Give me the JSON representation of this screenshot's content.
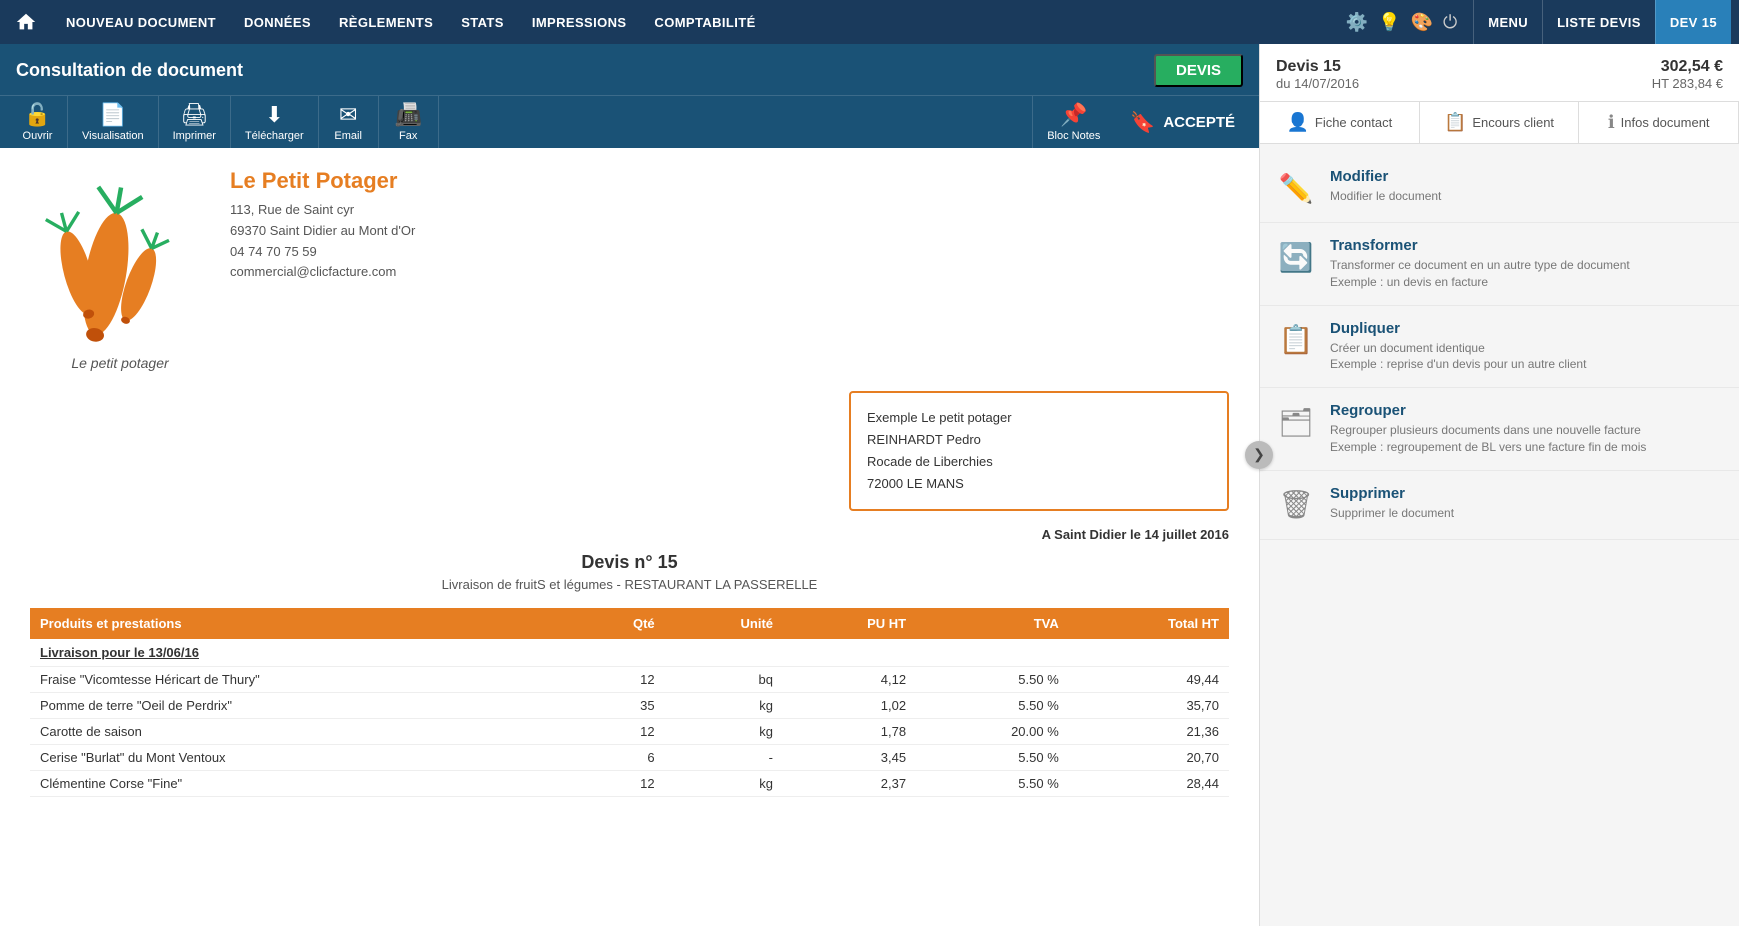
{
  "topNav": {
    "home_icon": "🏠",
    "items": [
      {
        "label": "NOUVEAU DOCUMENT",
        "active": false
      },
      {
        "label": "DONNÉES",
        "active": false
      },
      {
        "label": "RÈGLEMENTS",
        "active": false
      },
      {
        "label": "STATS",
        "active": false
      },
      {
        "label": "IMPRESSIONS",
        "active": false
      },
      {
        "label": "COMPTABILITÉ",
        "active": false
      }
    ],
    "icons": [
      "⚙️",
      "💡",
      "🎨",
      "⏻"
    ],
    "rightItems": [
      {
        "label": "MENU",
        "active": false
      },
      {
        "label": "LISTE DEVIS",
        "active": false
      },
      {
        "label": "DEV 15",
        "active": true
      }
    ]
  },
  "docHeader": {
    "title": "Consultation de document",
    "badge": "DEVIS",
    "toolbar": [
      {
        "icon": "🔓",
        "label": "Ouvrir"
      },
      {
        "icon": "📄",
        "label": "Visualisation"
      },
      {
        "icon": "🖨",
        "label": "Imprimer"
      },
      {
        "icon": "⬇",
        "label": "Télécharger"
      },
      {
        "icon": "✉",
        "label": "Email"
      },
      {
        "icon": "📠",
        "label": "Fax"
      }
    ],
    "bloc_notes_label": "Bloc Notes",
    "accepte_label": "ACCEPTÉ"
  },
  "company": {
    "name": "Le Petit Potager",
    "address1": "113, Rue de Saint cyr",
    "address2": "69370 Saint Didier au Mont d'Or",
    "phone": "04 74 70 75 59",
    "email": "commercial@clicfacture.com",
    "logo_name": "Le petit potager"
  },
  "recipient": {
    "line1": "Exemple Le petit potager",
    "line2": "REINHARDT Pedro",
    "line3": "Rocade de Liberchies",
    "line4": "72000 LE MANS"
  },
  "document": {
    "date_location": "A Saint Didier le 14 juillet 2016",
    "title": "Devis n° 15",
    "subtitle": "Livraison de fruitS et légumes - RESTAURANT LA PASSERELLE"
  },
  "table": {
    "headers": [
      "Produits et prestations",
      "Qté",
      "Unité",
      "PU HT",
      "TVA",
      "Total HT"
    ],
    "sections": [
      {
        "section_title": "Livraison pour le 13/06/16",
        "rows": [
          {
            "product": "Fraise \"Vicomtesse Héricart de Thury\"",
            "qty": "12",
            "unite": "bq",
            "pu_ht": "4,12",
            "tva": "5.50 %",
            "total_ht": "49,44"
          },
          {
            "product": "Pomme de terre \"Oeil de Perdrix\"",
            "qty": "35",
            "unite": "kg",
            "pu_ht": "1,02",
            "tva": "5.50 %",
            "total_ht": "35,70"
          },
          {
            "product": "Carotte de saison",
            "qty": "12",
            "unite": "kg",
            "pu_ht": "1,78",
            "tva": "20.00 %",
            "total_ht": "21,36"
          },
          {
            "product": "Cerise \"Burlat\" du Mont Ventoux",
            "qty": "6",
            "unite": "-",
            "pu_ht": "3,45",
            "tva": "5.50 %",
            "total_ht": "20,70"
          },
          {
            "product": "Clémentine Corse \"Fine\"",
            "qty": "12",
            "unite": "kg",
            "pu_ht": "2,37",
            "tva": "5.50 %",
            "total_ht": "28,44"
          }
        ]
      }
    ]
  },
  "rightPanel": {
    "devis_title": "Devis 15",
    "devis_date": "du 14/07/2016",
    "amount_ttc": "302,54 €",
    "amount_ht_label": "HT 283,84 €",
    "tabs": [
      {
        "icon": "👤",
        "label": "Fiche contact"
      },
      {
        "icon": "📋",
        "label": "Encours client"
      },
      {
        "icon": "ℹ",
        "label": "Infos document"
      }
    ],
    "actions": [
      {
        "icon": "✏️",
        "title": "Modifier",
        "desc": "Modifier le document"
      },
      {
        "icon": "🔄",
        "title": "Transformer",
        "desc": "Transformer ce document en un autre type de document\nExemple : un devis en facture"
      },
      {
        "icon": "📋",
        "title": "Dupliquer",
        "desc": "Créer un document identique\nExemple : reprise d'un devis pour un autre client"
      },
      {
        "icon": "🗂",
        "title": "Regrouper",
        "desc": "Regrouper plusieurs documents dans une nouvelle facture\nExemple : regroupement de BL vers une facture fin de mois"
      },
      {
        "icon": "🗑",
        "title": "Supprimer",
        "desc": "Supprimer le document"
      }
    ],
    "toggle_icon": "❯"
  }
}
